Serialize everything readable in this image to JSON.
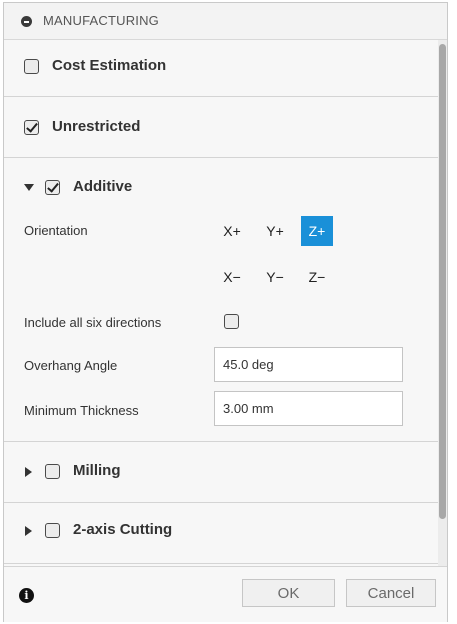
{
  "panel": {
    "title": "MANUFACTURING"
  },
  "sections": {
    "cost_estimation": {
      "label": "Cost Estimation",
      "checked": false
    },
    "unrestricted": {
      "label": "Unrestricted",
      "checked": true
    },
    "additive": {
      "label": "Additive",
      "checked": true,
      "expanded": true,
      "orientation_label": "Orientation",
      "orientations": [
        "X+",
        "Y+",
        "Z+",
        "X−",
        "Y−",
        "Z−"
      ],
      "selected_orientation": "Z+",
      "include_six_label": "Include all six directions",
      "include_six_checked": false,
      "overhang_label": "Overhang Angle",
      "overhang_value": "45.0 deg",
      "min_thickness_label": "Minimum Thickness",
      "min_thickness_value": "3.00 mm"
    },
    "milling": {
      "label": "Milling",
      "checked": false,
      "expanded": false
    },
    "two_axis": {
      "label": "2-axis Cutting",
      "checked": false,
      "expanded": false
    }
  },
  "footer": {
    "ok_label": "OK",
    "cancel_label": "Cancel"
  },
  "colors": {
    "accent": "#1a90d8"
  },
  "icons": {
    "collapse": "collapse-icon",
    "info": "info-icon"
  }
}
